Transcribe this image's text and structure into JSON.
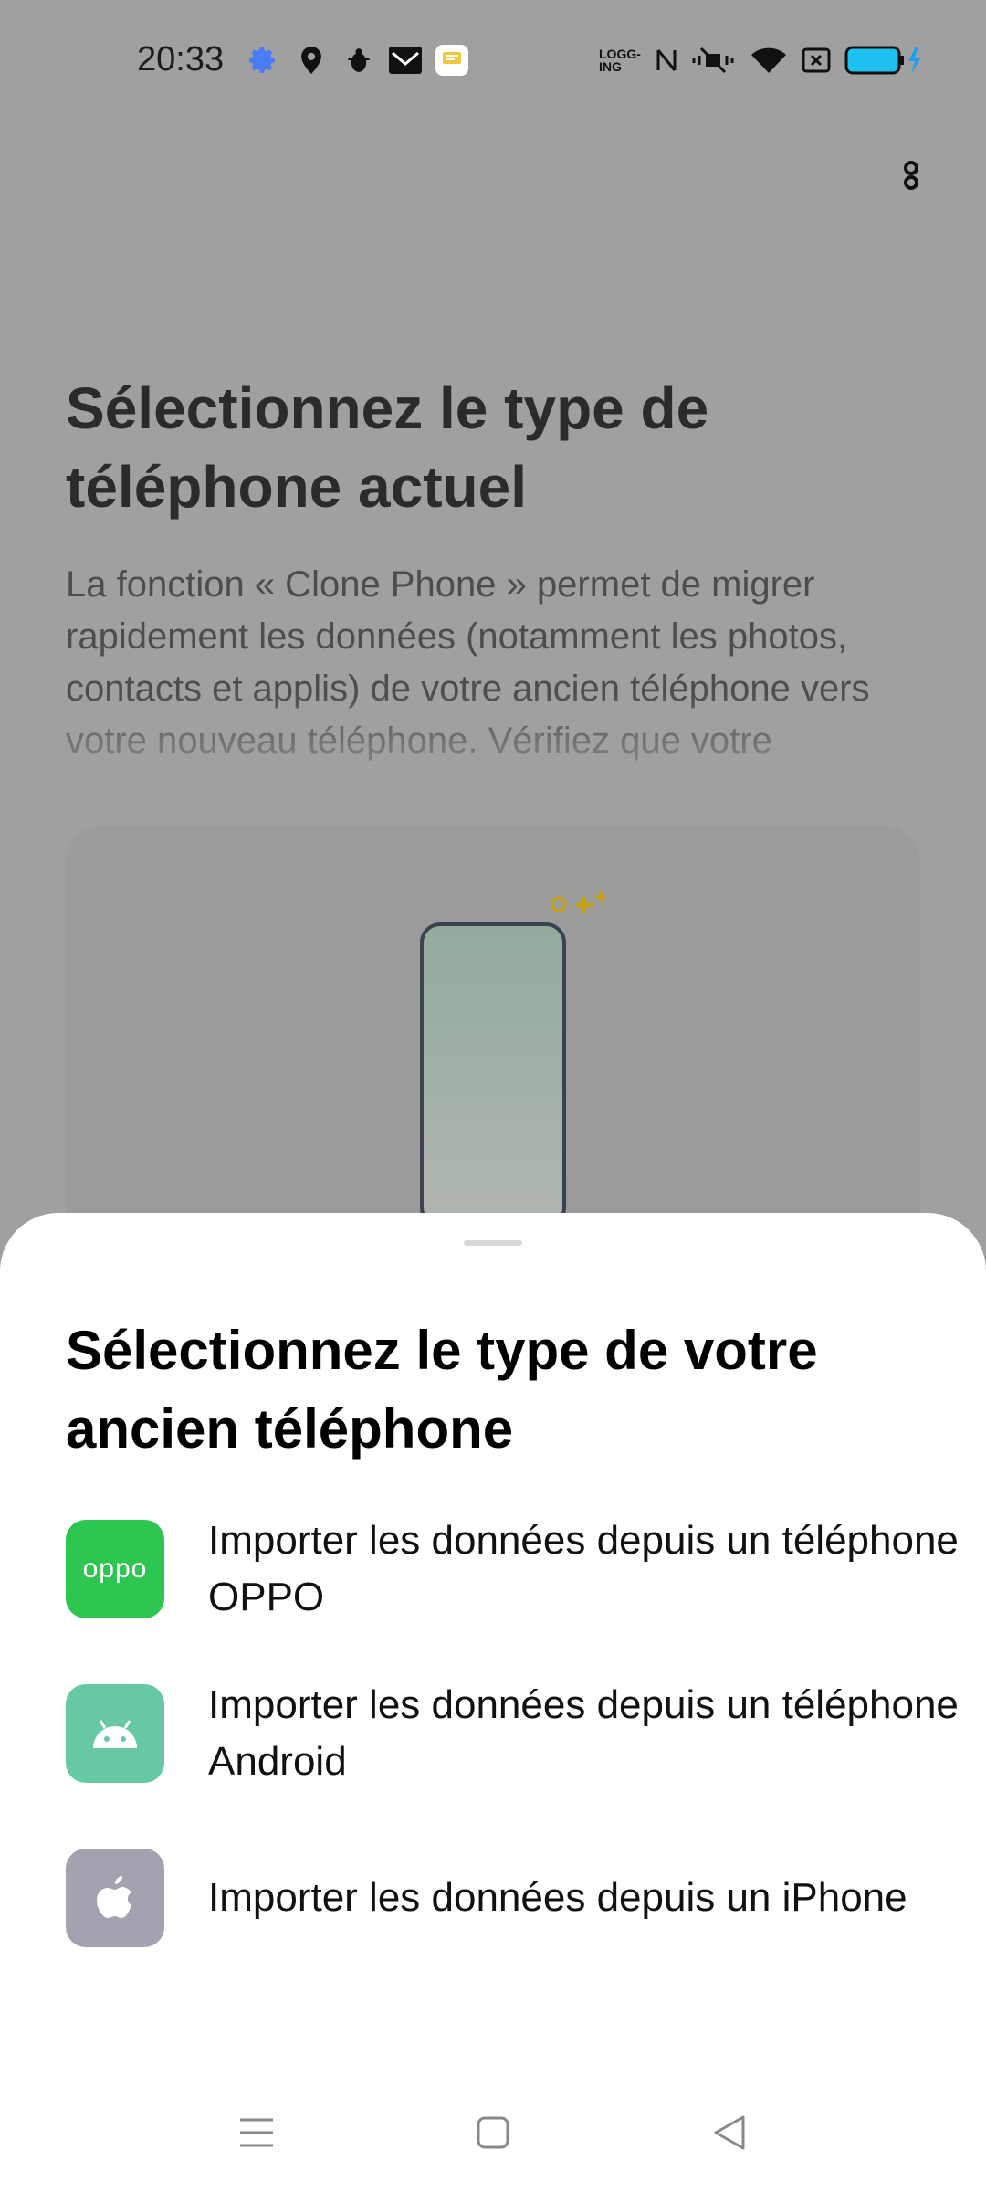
{
  "status_bar": {
    "time": "20:33",
    "left_icons": [
      "settings-gear-icon",
      "location-pin-icon",
      "bug-icon",
      "mail-icon",
      "message-icon"
    ],
    "right_icons": [
      "logging-icon",
      "nfc-icon",
      "vibrate-silent-icon",
      "wifi-icon",
      "close-box-icon",
      "battery-charging-icon"
    ],
    "logging_text": "LOGG-ING",
    "accent_color": "#4a7cf5"
  },
  "background_page": {
    "title": "Sélectionnez le type de téléphone actuel",
    "description": "La fonction « Clone Phone » permet de migrer rapidement les données (notamment les photos, contacts et applis) de votre ancien téléphone vers votre nouveau téléphone. Vérifiez que votre"
  },
  "sheet": {
    "title": "Sélectionnez le type de votre ancien téléphone",
    "options": [
      {
        "label": "Importer les données depuis un téléphone OPPO",
        "icon": "oppo-logo-icon",
        "icon_text": "oppo",
        "color": "#2dc650"
      },
      {
        "label": "Importer les données depuis un téléphone Android",
        "icon": "android-icon",
        "color": "#66c9a4"
      },
      {
        "label": "Importer les données depuis un iPhone",
        "icon": "apple-icon",
        "color": "#a3a3b0"
      }
    ]
  },
  "nav_bar": {
    "icons": [
      "menu-icon",
      "home-square-icon",
      "back-triangle-icon"
    ]
  }
}
